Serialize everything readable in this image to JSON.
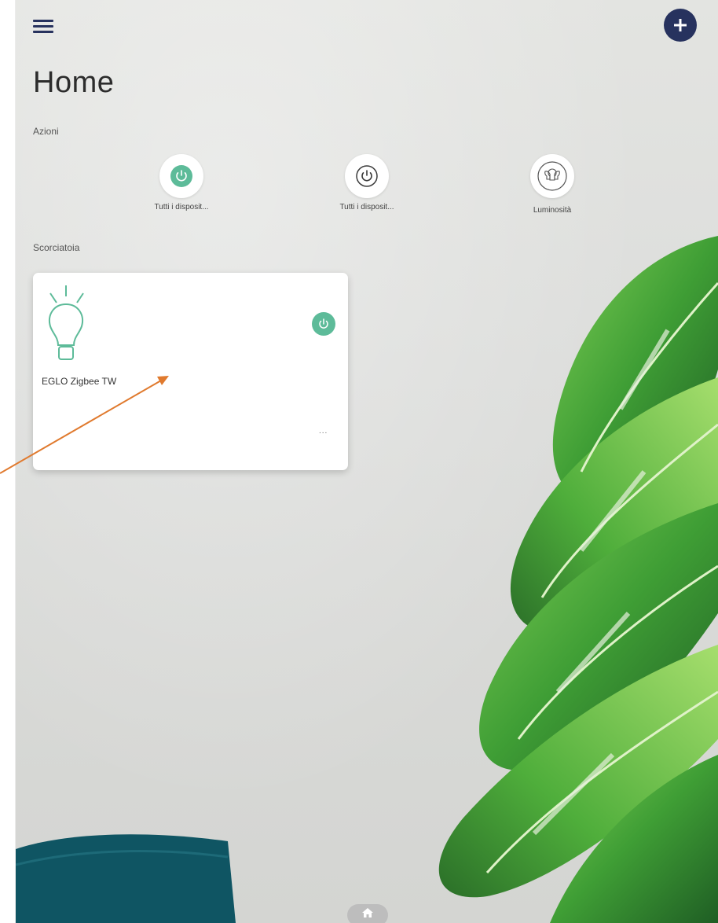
{
  "header": {
    "title": "Home"
  },
  "sections": {
    "actions_label": "Azioni",
    "shortcuts_label": "Scorciatoia"
  },
  "actions": [
    {
      "label": "Tutti i disposit...",
      "icon": "power-icon",
      "state": "on"
    },
    {
      "label": "Tutti i disposit...",
      "icon": "power-icon",
      "state": "off"
    },
    {
      "label": "Luminosità",
      "icon": "bulbs-icon"
    }
  ],
  "shortcut_card": {
    "device_name": "EGLO Zigbee TW",
    "more_label": "...",
    "icon": "bulb-icon",
    "power_state": "on"
  },
  "colors": {
    "accent_green": "#5dbb99",
    "navy": "#27325e",
    "annotation_arrow": "#e07a2e"
  }
}
